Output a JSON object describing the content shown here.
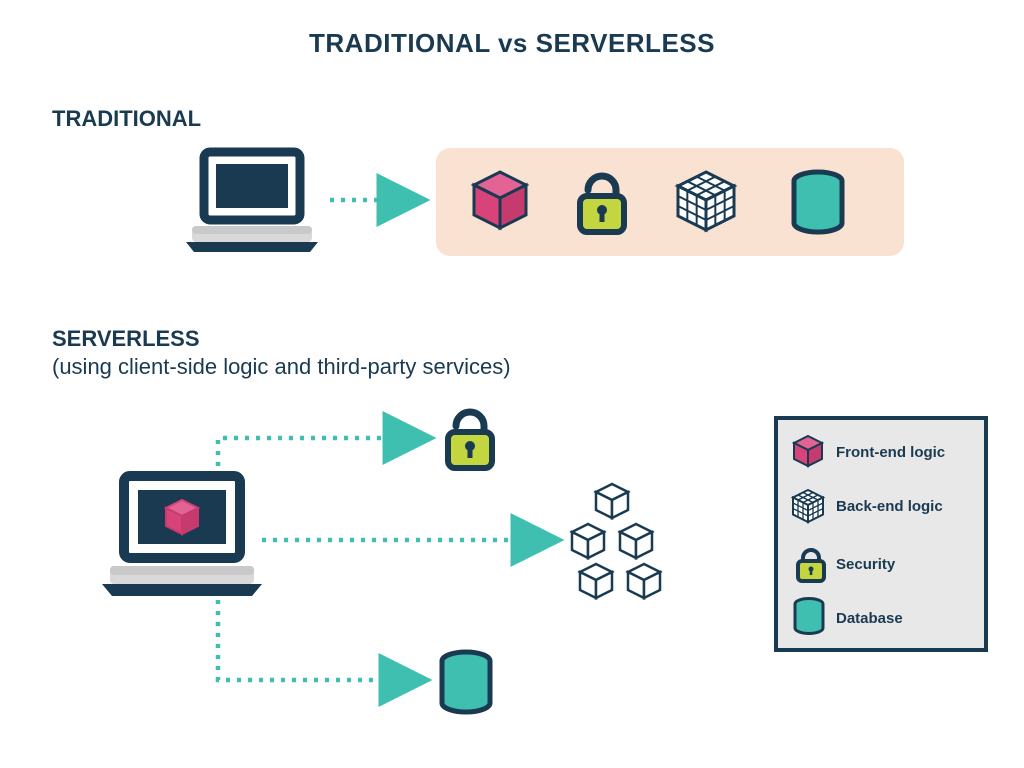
{
  "title": "TRADITIONAL vs SERVERLESS",
  "sections": {
    "traditional": {
      "heading": "TRADITIONAL"
    },
    "serverless": {
      "heading": "SERVERLESS",
      "subheading": "(using client-side logic and third-party services)"
    }
  },
  "legend": {
    "items": [
      {
        "label": "Front-end logic"
      },
      {
        "label": "Back-end logic"
      },
      {
        "label": "Security"
      },
      {
        "label": "Database"
      }
    ]
  },
  "colors": {
    "navy": "#1a3a52",
    "teal": "#3fbfb0",
    "peach": "#f9e2d2",
    "pink": "#d8447a",
    "lime": "#c4d63f",
    "boxGrey": "#e8e8e8",
    "lightGrey": "#d9d9d9"
  }
}
